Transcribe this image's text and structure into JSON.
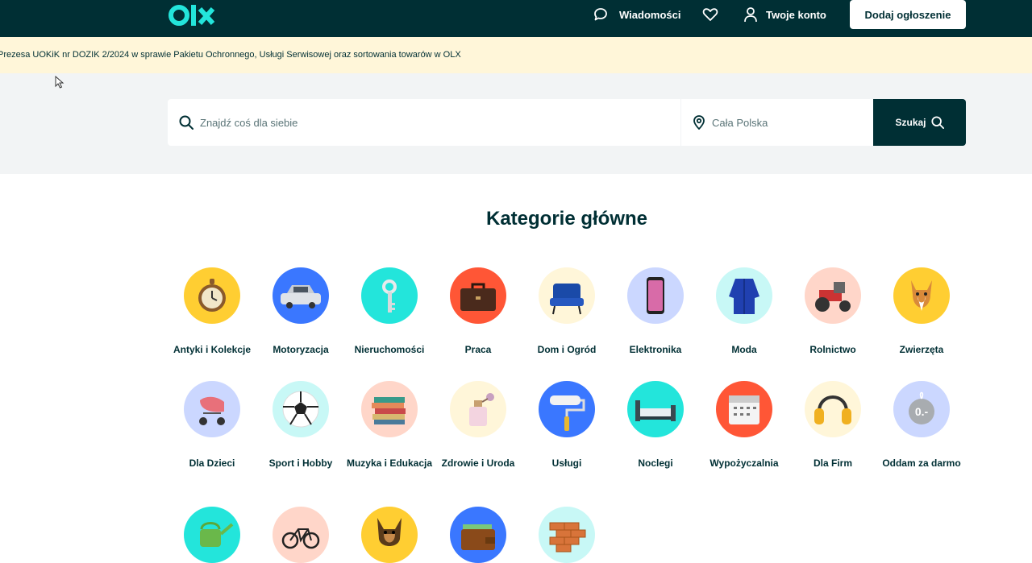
{
  "header": {
    "logo_text": "olx",
    "messages_label": "Wiadomości",
    "account_label": "Twoje konto",
    "add_listing_label": "Dodaj ogłoszenie"
  },
  "banner": {
    "text": "Prezesa UOKiK nr DOZIK 2/2024 w sprawie Pakietu Ochronnego, Usługi Serwisowej oraz sortowania towarów w OLX"
  },
  "search": {
    "placeholder": "Znajdź coś dla siebie",
    "location_placeholder": "Cała Polska",
    "button_label": "Szukaj"
  },
  "categories": {
    "title": "Kategorie główne",
    "items": [
      {
        "label": "Antyki i Kolekcje",
        "color": "#ffce32",
        "icon": "pocket-watch-icon"
      },
      {
        "label": "Motoryzacja",
        "color": "#3a77ff",
        "icon": "car-icon"
      },
      {
        "label": "Nieruchomości",
        "color": "#23e5db",
        "icon": "key-icon"
      },
      {
        "label": "Praca",
        "color": "#ff5636",
        "icon": "briefcase-icon"
      },
      {
        "label": "Dom i Ogród",
        "color": "#fff6d9",
        "icon": "armchair-icon"
      },
      {
        "label": "Elektronika",
        "color": "#cbd7ff",
        "icon": "smartphone-icon"
      },
      {
        "label": "Moda",
        "color": "#c8f8f6",
        "icon": "robe-icon"
      },
      {
        "label": "Rolnictwo",
        "color": "#ffd6c9",
        "icon": "tractor-icon"
      },
      {
        "label": "Zwierzęta",
        "color": "#ffce32",
        "icon": "dog-icon"
      },
      {
        "label": "Dla Dzieci",
        "color": "#cbd7ff",
        "icon": "stroller-icon"
      },
      {
        "label": "Sport i Hobby",
        "color": "#c8f8f6",
        "icon": "soccer-ball-icon"
      },
      {
        "label": "Muzyka i Edukacja",
        "color": "#ffd6c9",
        "icon": "books-icon"
      },
      {
        "label": "Zdrowie i Uroda",
        "color": "#fff6d9",
        "icon": "perfume-icon"
      },
      {
        "label": "Usługi",
        "color": "#3a77ff",
        "icon": "paint-roller-icon"
      },
      {
        "label": "Noclegi",
        "color": "#23e5db",
        "icon": "bed-icon"
      },
      {
        "label": "Wypożyczalnia",
        "color": "#ff5636",
        "icon": "calendar-icon"
      },
      {
        "label": "Dla Firm",
        "color": "#fff6d9",
        "icon": "ear-muffs-icon"
      },
      {
        "label": "Oddam za darmo",
        "color": "#cbd7ff",
        "icon": "price-tag-icon",
        "tag_text": "0.-"
      },
      {
        "label": "",
        "color": "#23e5db",
        "icon": "watering-can-icon"
      },
      {
        "label": "",
        "color": "#ffd6c9",
        "icon": "bicycle-icon"
      },
      {
        "label": "",
        "color": "#ffce32",
        "icon": "german-shepherd-icon"
      },
      {
        "label": "",
        "color": "#3a77ff",
        "icon": "wallet-icon"
      },
      {
        "label": "",
        "color": "#c8f8f6",
        "icon": "bricks-icon"
      }
    ]
  }
}
